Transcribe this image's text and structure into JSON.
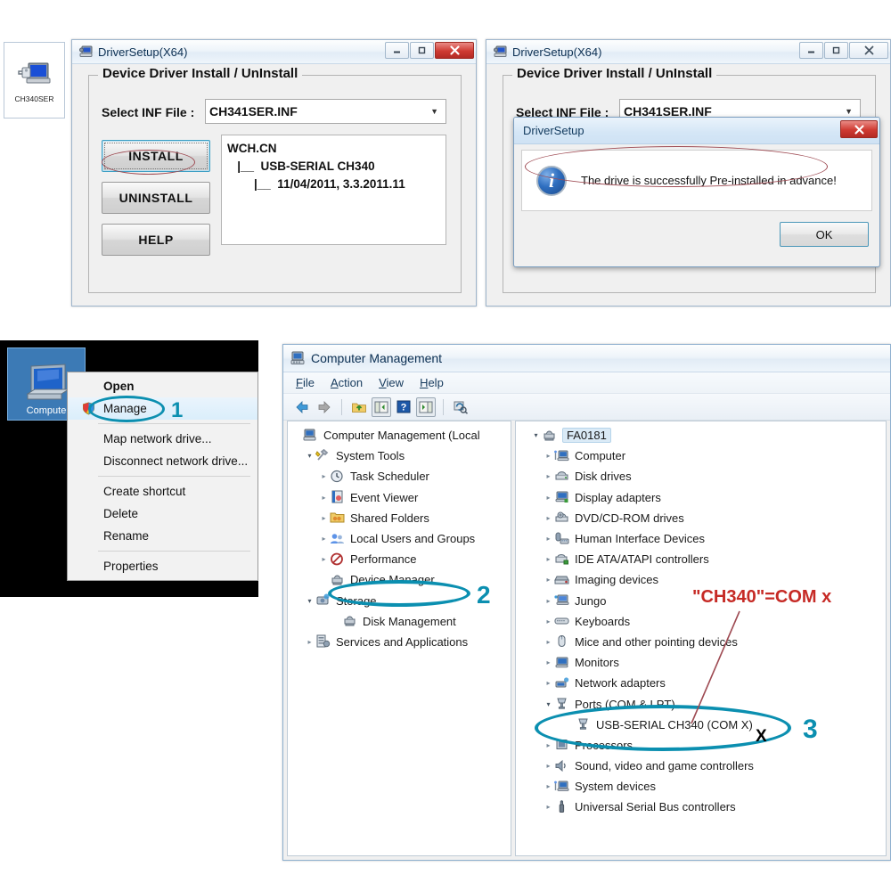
{
  "desktop_icon": {
    "icon_name": "ch340ser-usb-driver-icon",
    "caption": "CH340SER"
  },
  "driver_setup_window_1": {
    "title": "DriverSetup(X64)",
    "icon": "driver-setup-icon",
    "buttons": {
      "minimize": "–",
      "maximize": "❒",
      "close": "✕"
    },
    "groupbox_legend": "Device Driver Install / UnInstall",
    "inf_label": "Select INF File :",
    "inf_value": "CH341SER.INF",
    "install_label": "INSTALL",
    "uninstall_label": "UNINSTALL",
    "help_label": "HELP",
    "info_lines": [
      "WCH.CN",
      "   |__  USB-SERIAL CH340",
      "        |__  11/04/2011, 3.3.2011.11"
    ],
    "info_text": "WCH.CN\n   |__  USB-SERIAL CH340\n        |__  11/04/2011, 3.3.2011.11"
  },
  "driver_setup_window_2": {
    "title": "DriverSetup(X64)",
    "icon": "driver-setup-icon",
    "buttons": {
      "minimize": "–",
      "maximize": "❒",
      "close": "✖"
    },
    "groupbox_legend": "Device Driver Install / UnInstall",
    "inf_label": "Select INF File :",
    "inf_value": "CH341SER.INF"
  },
  "message_dialog": {
    "title": "DriverSetup",
    "close_label": "✕",
    "icon": "info-icon",
    "icon_glyph": "i",
    "message": "The drive is successfully Pre-installed in advance!",
    "ok_label": "OK"
  },
  "context_menu": {
    "desktop_icon_caption": "Compute",
    "items": [
      {
        "label": "Open",
        "bold": true,
        "shield": false,
        "selected": false,
        "separator_after": false
      },
      {
        "label": "Manage",
        "bold": false,
        "shield": true,
        "selected": true,
        "separator_after": true
      },
      {
        "label": "Map network drive...",
        "bold": false,
        "shield": false,
        "selected": false,
        "separator_after": false
      },
      {
        "label": "Disconnect network drive...",
        "bold": false,
        "shield": false,
        "selected": false,
        "separator_after": true
      },
      {
        "label": "Create shortcut",
        "bold": false,
        "shield": false,
        "selected": false,
        "separator_after": false
      },
      {
        "label": "Delete",
        "bold": false,
        "shield": false,
        "selected": false,
        "separator_after": false
      },
      {
        "label": "Rename",
        "bold": false,
        "shield": false,
        "selected": false,
        "separator_after": true
      },
      {
        "label": "Properties",
        "bold": false,
        "shield": false,
        "selected": false,
        "separator_after": false
      }
    ]
  },
  "computer_management": {
    "title": "Computer Management",
    "icon": "computer-management-icon",
    "menus": [
      "File",
      "Action",
      "View",
      "Help"
    ],
    "toolbar_icons": [
      "back-arrow-icon",
      "forward-arrow-icon",
      "separator",
      "up-folder-icon",
      "show-hide-console-tree-icon",
      "help-icon",
      "show-hide-action-pane-icon",
      "refresh-icon"
    ],
    "left_tree": [
      {
        "label": "Computer Management (Local",
        "depth": 0,
        "twisty": "none",
        "icon": "computer-management-icon"
      },
      {
        "label": "System Tools",
        "depth": 1,
        "twisty": "open",
        "icon": "system-tools-icon"
      },
      {
        "label": "Task Scheduler",
        "depth": 2,
        "twisty": "closed",
        "icon": "task-scheduler-icon"
      },
      {
        "label": "Event Viewer",
        "depth": 2,
        "twisty": "closed",
        "icon": "event-viewer-icon"
      },
      {
        "label": "Shared Folders",
        "depth": 2,
        "twisty": "closed",
        "icon": "shared-folders-icon"
      },
      {
        "label": "Local Users and Groups",
        "depth": 2,
        "twisty": "closed",
        "icon": "local-users-icon"
      },
      {
        "label": "Performance",
        "depth": 2,
        "twisty": "closed",
        "icon": "performance-icon"
      },
      {
        "label": "Device Manager",
        "depth": 2,
        "twisty": "none",
        "icon": "device-manager-icon"
      },
      {
        "label": "Storage",
        "depth": 1,
        "twisty": "open",
        "icon": "storage-icon"
      },
      {
        "label": "Disk Management",
        "depth": 2,
        "twisty": "none",
        "icon": "disk-management-icon"
      },
      {
        "label": "Services and Applications",
        "depth": 1,
        "twisty": "closed",
        "icon": "services-icon"
      }
    ],
    "right_tree": [
      {
        "label": "FA0181",
        "depth": 0,
        "twisty": "open",
        "icon": "computer-node-icon",
        "selected": true
      },
      {
        "label": "Computer",
        "depth": 1,
        "twisty": "closed",
        "icon": "computer-icon"
      },
      {
        "label": "Disk drives",
        "depth": 1,
        "twisty": "closed",
        "icon": "disk-drive-icon"
      },
      {
        "label": "Display adapters",
        "depth": 1,
        "twisty": "closed",
        "icon": "display-adapter-icon"
      },
      {
        "label": "DVD/CD-ROM drives",
        "depth": 1,
        "twisty": "closed",
        "icon": "dvd-drive-icon"
      },
      {
        "label": "Human Interface Devices",
        "depth": 1,
        "twisty": "closed",
        "icon": "hid-icon"
      },
      {
        "label": "IDE ATA/ATAPI controllers",
        "depth": 1,
        "twisty": "closed",
        "icon": "ide-controller-icon"
      },
      {
        "label": "Imaging devices",
        "depth": 1,
        "twisty": "closed",
        "icon": "imaging-device-icon"
      },
      {
        "label": "Jungo",
        "depth": 1,
        "twisty": "closed",
        "icon": "jungo-icon"
      },
      {
        "label": "Keyboards",
        "depth": 1,
        "twisty": "closed",
        "icon": "keyboard-icon"
      },
      {
        "label": "Mice and other pointing devices",
        "depth": 1,
        "twisty": "closed",
        "icon": "mouse-icon"
      },
      {
        "label": "Monitors",
        "depth": 1,
        "twisty": "closed",
        "icon": "monitor-icon"
      },
      {
        "label": "Network adapters",
        "depth": 1,
        "twisty": "closed",
        "icon": "network-adapter-icon"
      },
      {
        "label": "Ports (COM & LPT)",
        "depth": 1,
        "twisty": "open",
        "icon": "port-icon"
      },
      {
        "label": "USB-SERIAL CH340 (COM X)",
        "depth": 2,
        "twisty": "none",
        "icon": "port-icon"
      },
      {
        "label": "Processors",
        "depth": 1,
        "twisty": "closed",
        "icon": "processor-icon"
      },
      {
        "label": "Sound, video and game controllers",
        "depth": 1,
        "twisty": "closed",
        "icon": "sound-icon"
      },
      {
        "label": "System devices",
        "depth": 1,
        "twisty": "closed",
        "icon": "system-device-icon"
      },
      {
        "label": "Universal Serial Bus controllers",
        "depth": 1,
        "twisty": "closed",
        "icon": "usb-controller-icon"
      }
    ]
  },
  "annotations": {
    "step1": "1",
    "step2": "2",
    "step3": "3",
    "com_note": "\"CH340\"=COM x",
    "com_x_marker": "X",
    "highlight_color": "#0b8fb0",
    "note_color": "#c62a25",
    "red_ellipse_color": "#9e4a52"
  }
}
